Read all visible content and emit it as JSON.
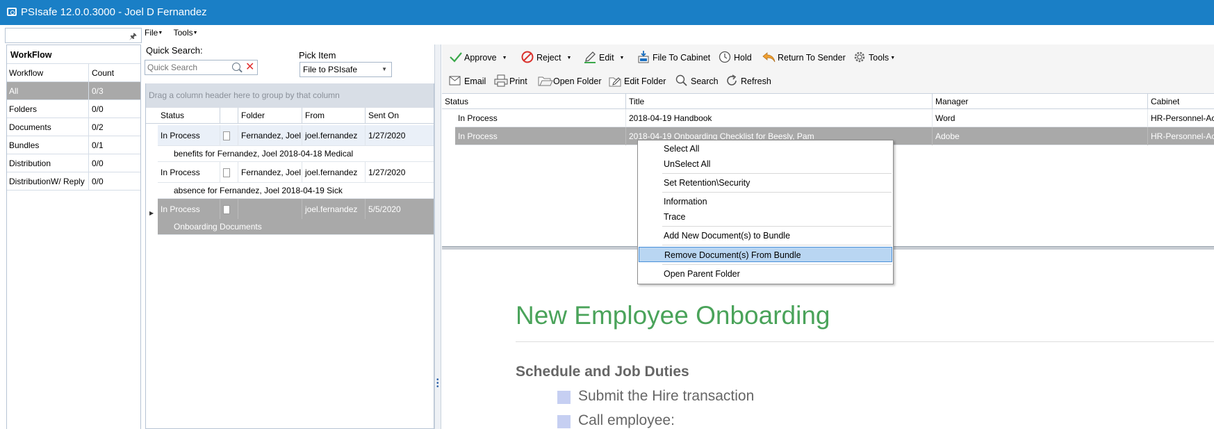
{
  "window": {
    "title": "PSIsafe 12.0.0.3000 - Joel D Fernandez"
  },
  "workflow_panel": {
    "title": "WorkFlow",
    "col_workflow": "Workflow",
    "col_count": "Count",
    "rows": [
      {
        "name": "All",
        "count": "0/3"
      },
      {
        "name": "Folders",
        "count": "0/0"
      },
      {
        "name": "Documents",
        "count": "0/2"
      },
      {
        "name": "Bundles",
        "count": "0/1"
      },
      {
        "name": "Distribution",
        "count": "0/0"
      },
      {
        "name": "DistributionW/ Reply",
        "count": "0/0"
      }
    ]
  },
  "menubar": {
    "file": "File",
    "tools": "Tools"
  },
  "quick_search": {
    "label": "Quick Search:",
    "placeholder": "Quick Search"
  },
  "pick_item": {
    "label": "Pick Item",
    "value": "File to PSIsafe"
  },
  "middle_grid": {
    "group_hint": "Drag a column header here to group by that column",
    "columns": [
      "Status",
      "",
      "Folder",
      "From",
      "Sent On"
    ],
    "rows": [
      {
        "status": "In Process",
        "folder": "Fernandez, Joel",
        "from": "joel.fernandez",
        "sent": "1/27/2020",
        "desc": "benefits for Fernandez, Joel 2018-04-18 Medical"
      },
      {
        "status": "In Process",
        "folder": "Fernandez, Joel",
        "from": "joel.fernandez",
        "sent": "1/27/2020",
        "desc": "absence for Fernandez, Joel 2018-04-19 Sick"
      },
      {
        "status": "In Process",
        "folder": "",
        "from": "joel.fernandez",
        "sent": "5/5/2020",
        "desc": "Onboarding Documents"
      }
    ]
  },
  "toolbar": {
    "approve": "Approve",
    "reject": "Reject",
    "edit": "Edit",
    "file_to_cabinet": "File To Cabinet",
    "hold": "Hold",
    "return_to_sender": "Return To Sender",
    "tools": "Tools",
    "email": "Email",
    "print": "Print",
    "open_folder": "Open Folder",
    "edit_folder": "Edit Folder",
    "search": "Search",
    "refresh": "Refresh"
  },
  "doc_grid": {
    "columns": [
      "Status",
      "Title",
      "Manager",
      "Cabinet"
    ],
    "rows": [
      {
        "status": "In Process",
        "title": "2018-04-19 Handbook",
        "manager": "Word",
        "cabinet": "HR-Personnel-Ac"
      },
      {
        "status": "In Process",
        "title": "2018-04-19 Onboarding Checklist for Beesly, Pam",
        "manager": "Adobe",
        "cabinet": "HR-Personnel-Ac"
      }
    ]
  },
  "context_menu": {
    "select_all": "Select All",
    "unselect_all": "UnSelect All",
    "set_retention": "Set Retention\\Security",
    "information": "Information",
    "trace": "Trace",
    "add_new_docs": "Add New Document(s) to Bundle",
    "remove_docs": "Remove Document(s) From Bundle",
    "open_parent": "Open Parent Folder"
  },
  "preview": {
    "title": "New Employee Onboarding",
    "heading": "Schedule and Job Duties",
    "bullets": [
      "Submit the Hire transaction",
      "Call employee:"
    ]
  },
  "colors": {
    "titlebar": "#1a7fc6",
    "doc_title": "#4aa35a",
    "selection": "#a9a9a9",
    "menu_highlight": "#b9d6f2"
  }
}
